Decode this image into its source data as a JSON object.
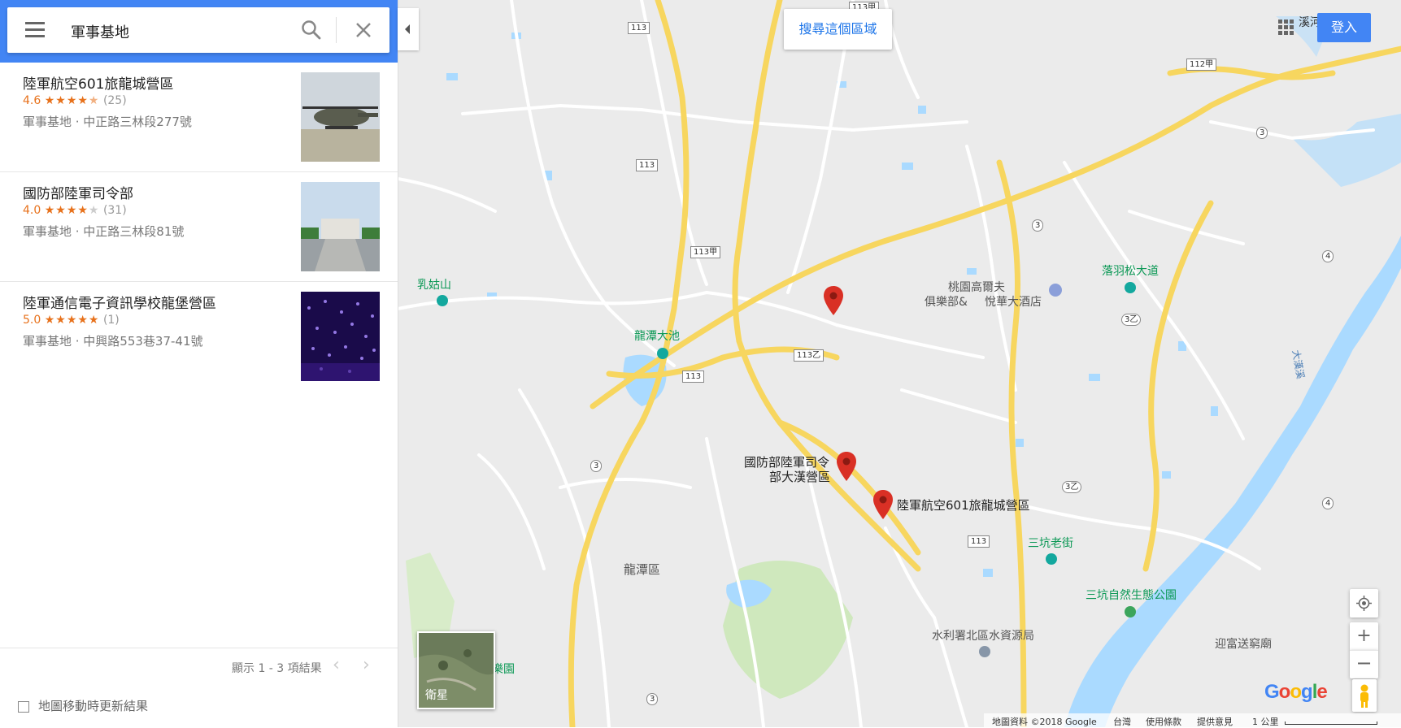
{
  "search": {
    "query": "軍事基地"
  },
  "results": [
    {
      "name": "陸軍航空601旅龍城營區",
      "rating": "4.6",
      "stars": "★★★★",
      "stars_half": "★",
      "stars_off": "",
      "count": "(25)",
      "meta": "軍事基地 · 中正路三林段277號"
    },
    {
      "name": "國防部陸軍司令部",
      "rating": "4.0",
      "stars": "★★★★",
      "stars_half": "",
      "stars_off": "★",
      "count": "(31)",
      "meta": "軍事基地 · 中正路三林段81號"
    },
    {
      "name": "陸軍通信電子資訊學校龍堡營區",
      "rating": "5.0",
      "stars": "★★★★★",
      "stars_half": "",
      "stars_off": "",
      "count": "(1)",
      "meta": "軍事基地 · 中興路553巷37-41號"
    }
  ],
  "pagination": {
    "text": "顯示 1 - 3 項結果"
  },
  "update_checkbox": {
    "label": "地圖移動時更新結果",
    "checked": false
  },
  "map": {
    "search_area_button": "搜尋這個區域",
    "signin_button": "登入",
    "satellite_label": "衛星",
    "google_logo": "Google",
    "attribution": {
      "data": "地圖資料 ©2018 Google",
      "region": "台灣",
      "terms": "使用條款",
      "feedback": "提供意見",
      "scale": "1 公里"
    },
    "pins": [
      {
        "label": ""
      },
      {
        "label": "國防部陸軍司令",
        "label2": "部大漢營區"
      },
      {
        "label": "陸軍航空601旅龍城營區"
      }
    ],
    "labels": {
      "rugu_mountain": "乳姑山",
      "longtan_pond": "龍潭大池",
      "golf_club_1": "桃園高爾夫",
      "golf_club_2": "俱樂部&",
      "hotel": "悅華大酒店",
      "luoyusong": "落羽松大道",
      "longtan_district": "龍潭區",
      "sankeng_street": "三坑老街",
      "sankeng_park": "三坑自然生態公園",
      "water_bureau": "水利署北區水資源局",
      "yingfu_temple": "迎富送窮廟",
      "river": "大漢溪",
      "park_partial": "樂園",
      "top_right": "溪河濱"
    },
    "shields": [
      "113",
      "113",
      "113甲",
      "113乙",
      "113",
      "113",
      "113甲",
      "112甲",
      "3",
      "3",
      "3",
      "3乙",
      "3乙",
      "4",
      "4",
      "3"
    ],
    "colors": {
      "road_major": "#f7d65f",
      "road_minor": "#ffffff",
      "water": "#aadaff",
      "park": "#c8e6b4",
      "pin": "#d93025",
      "accent": "#4285f4"
    }
  }
}
